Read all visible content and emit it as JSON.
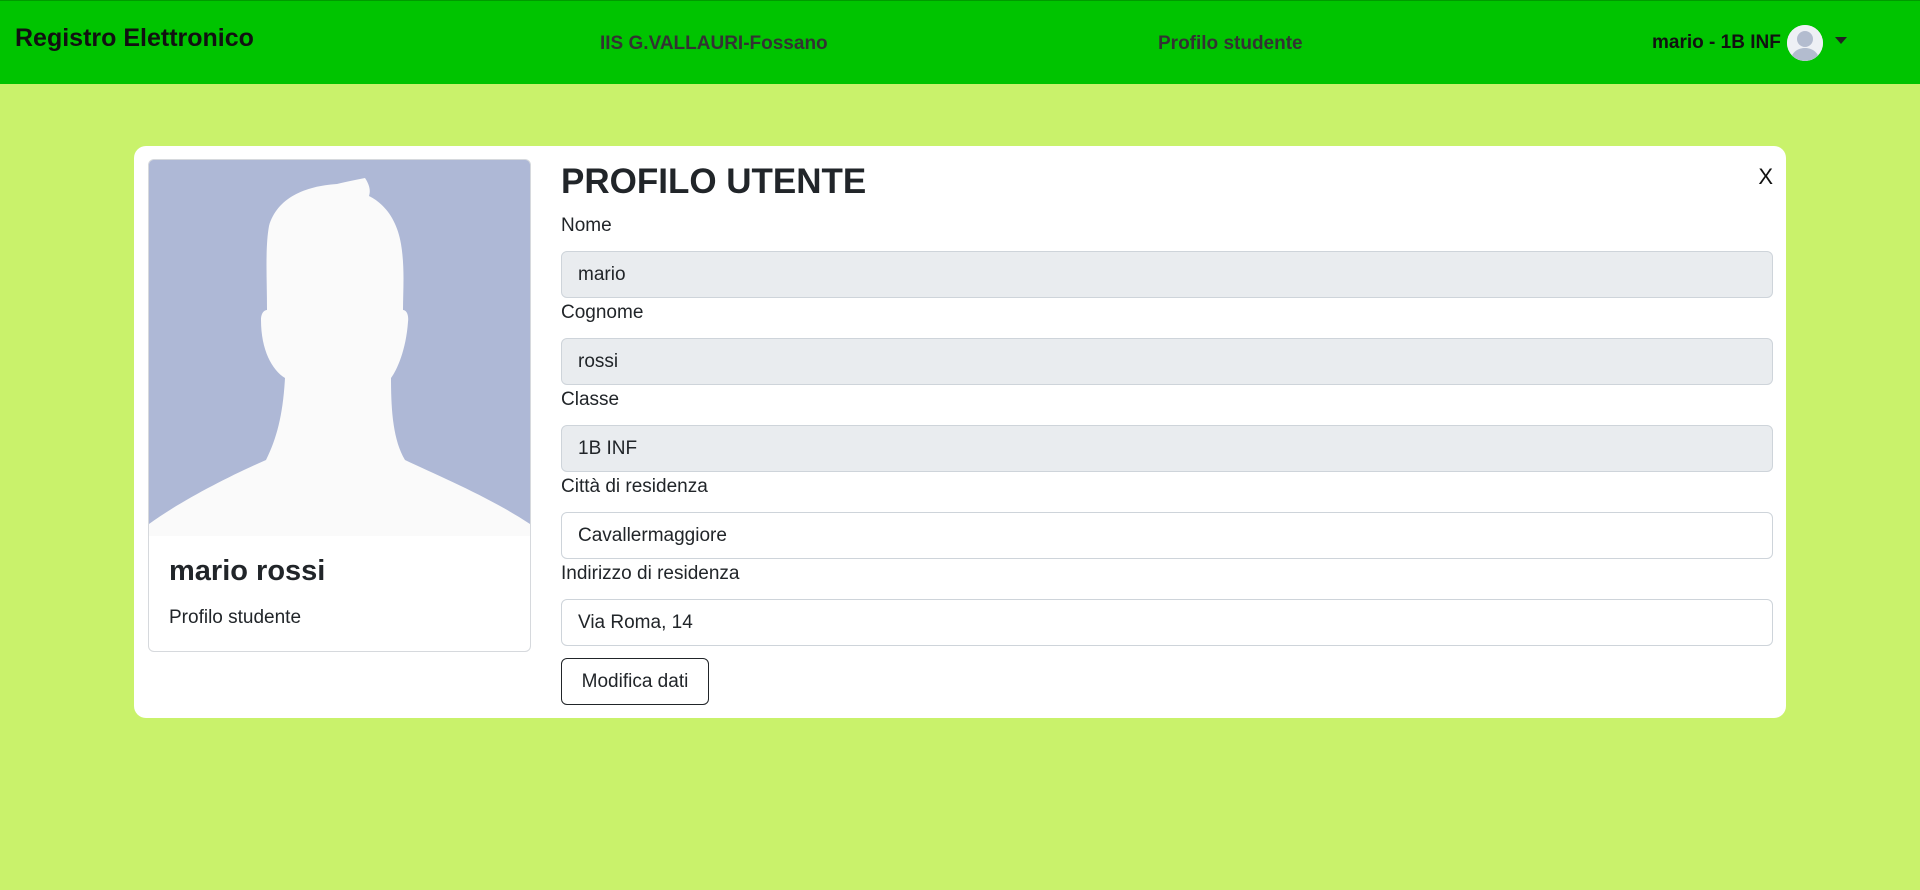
{
  "colors": {
    "navbar_bg": "#00c400",
    "page_bg": "#c9f26b",
    "panel_bg": "#ffffff",
    "readonly_input_bg": "#e9ecef",
    "avatar_bg": "#aeb8d6"
  },
  "navbar": {
    "brand": "Registro Elettronico",
    "school": "IIS G.VALLAURI-Fossano",
    "section": "Profilo studente",
    "user_label": "mario - 1B INF",
    "avatar_icon": "user-avatar-icon",
    "dropdown_icon": "caret-down-icon"
  },
  "card": {
    "image_icon": "default-user-silhouette",
    "name": "mario rossi",
    "subtitle": "Profilo studente"
  },
  "form": {
    "title": "PROFILO UTENTE",
    "close_label": "X",
    "fields": [
      {
        "label": "Nome",
        "value": "mario",
        "readonly": true
      },
      {
        "label": "Cognome",
        "value": "rossi",
        "readonly": true
      },
      {
        "label": "Classe",
        "value": "1B INF",
        "readonly": true
      },
      {
        "label": "Città di residenza",
        "value": "Cavallermaggiore",
        "readonly": false
      },
      {
        "label": "Indirizzo di residenza",
        "value": "Via Roma, 14",
        "readonly": false
      }
    ],
    "submit_label": "Modifica dati"
  }
}
